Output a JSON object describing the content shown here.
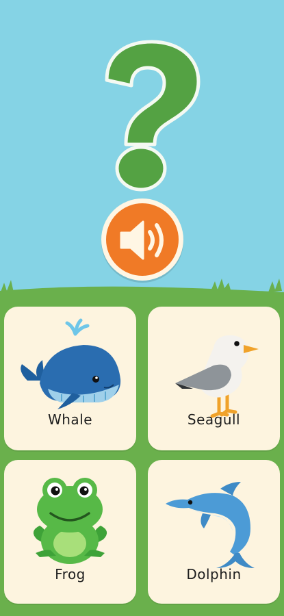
{
  "prompt": {
    "question_mark_symbol": "?",
    "play_sound_icon": "speaker-icon"
  },
  "options": [
    {
      "label": "Whale",
      "icon": "whale-icon"
    },
    {
      "label": "Seagull",
      "icon": "seagull-icon"
    },
    {
      "label": "Frog",
      "icon": "frog-icon"
    },
    {
      "label": "Dolphin",
      "icon": "dolphin-icon"
    }
  ],
  "colors": {
    "sky": "#85d3e5",
    "grass": "#6ab04c",
    "question_mark": "#54a243",
    "sound_button": "#f07a26",
    "card_background": "#fdf4df"
  }
}
